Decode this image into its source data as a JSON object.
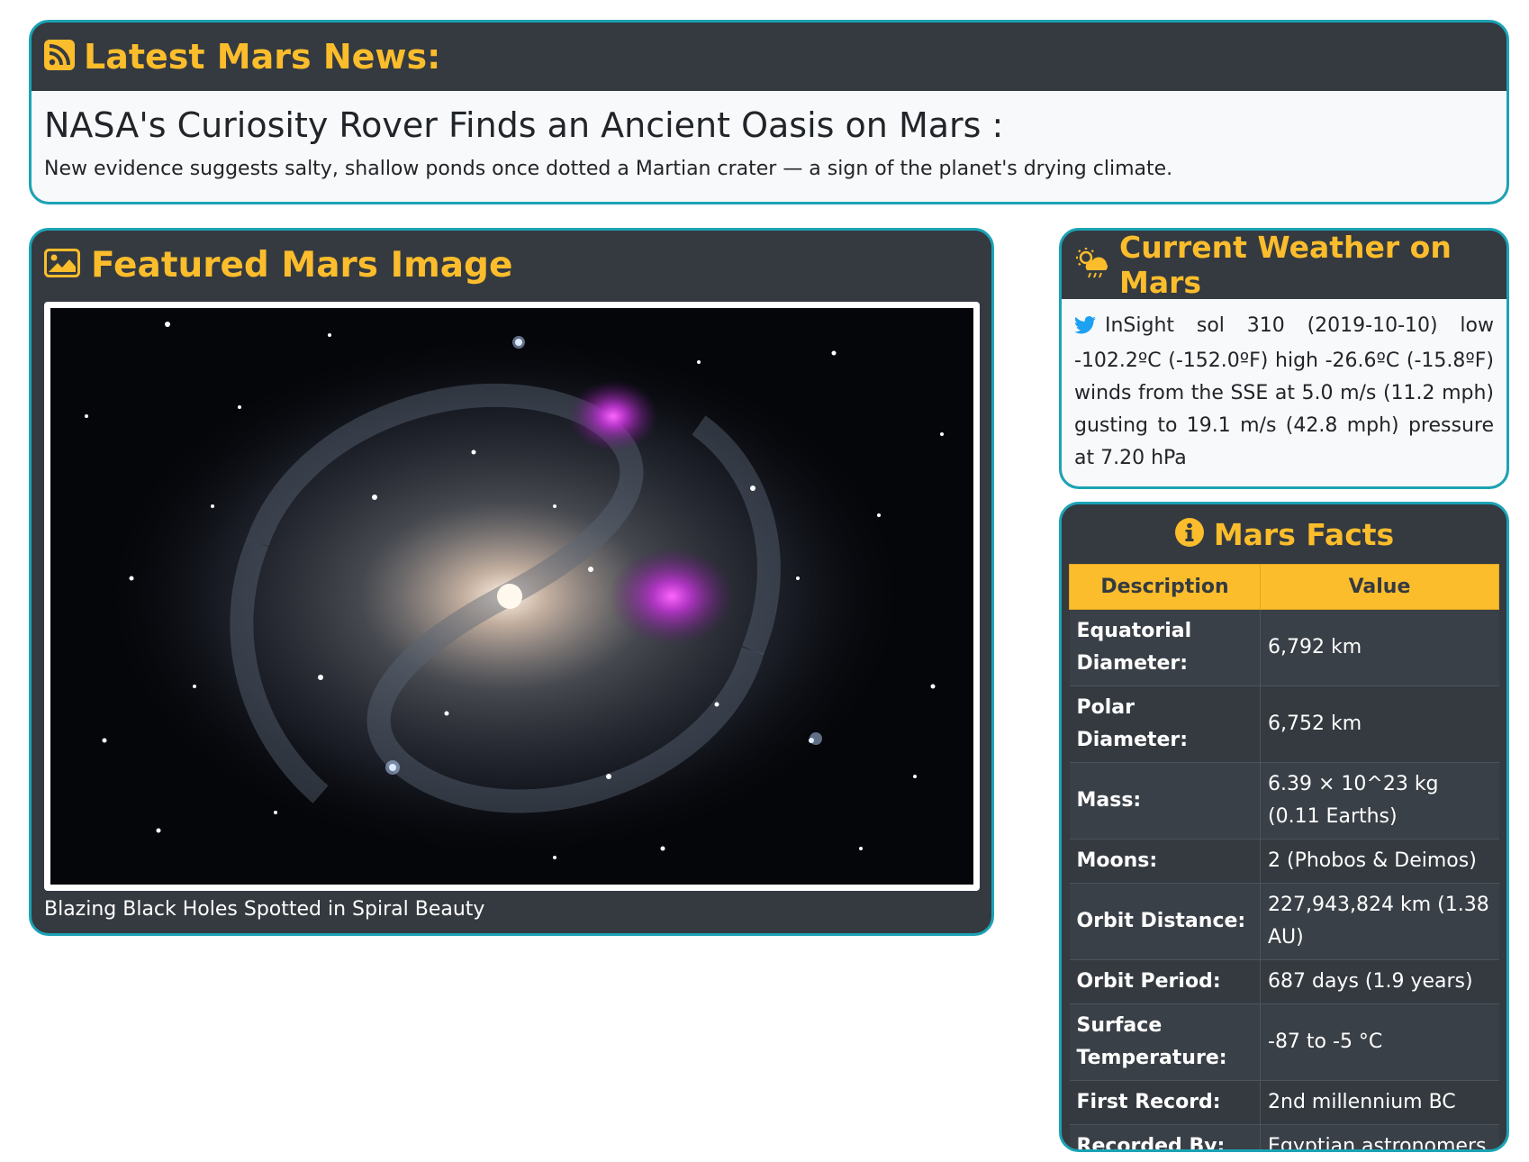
{
  "news": {
    "header": "Latest Mars News:",
    "header_icon": "rss-icon",
    "title": "NASA's Curiosity Rover Finds an Ancient Oasis on Mars :",
    "teaser": "New evidence suggests salty, shallow ponds once dotted a Martian crater — a sign of the planet's drying climate."
  },
  "featured": {
    "header": "Featured Mars Image",
    "header_icon": "image-icon",
    "caption": "Blazing Black Holes Spotted in Spiral Beauty"
  },
  "weather": {
    "header": "Current Weather on Mars",
    "header_icon": "sun-cloud-rain-icon",
    "source_icon": "twitter-icon",
    "text": "InSight sol 310 (2019-10-10) low -102.2ºC (-152.0ºF) high -26.6ºC (-15.8ºF) winds from the SSE at 5.0 m/s (11.2 mph) gusting to 19.1 m/s (42.8 mph) pressure at 7.20 hPa"
  },
  "facts": {
    "header": "Mars Facts",
    "header_icon": "info-circle-icon",
    "columns": [
      "Description",
      "Value"
    ],
    "rows": [
      {
        "label": "Equatorial Diameter:",
        "value": "6,792 km"
      },
      {
        "label": "Polar Diameter:",
        "value": "6,752 km"
      },
      {
        "label": "Mass:",
        "value": "6.39 × 10^23 kg (0.11 Earths)"
      },
      {
        "label": "Moons:",
        "value": "2 (Phobos & Deimos)"
      },
      {
        "label": "Orbit Distance:",
        "value": "227,943,824 km (1.38 AU)"
      },
      {
        "label": "Orbit Period:",
        "value": "687 days (1.9 years)"
      },
      {
        "label": "Surface Temperature:",
        "value": "-87 to -5 °C"
      },
      {
        "label": "First Record:",
        "value": "2nd millennium BC"
      },
      {
        "label": "Recorded By:",
        "value": "Egyptian astronomers"
      }
    ]
  },
  "colors": {
    "accent": "#fcbd2c",
    "border": "#1ba3b5",
    "dark": "#343a40"
  }
}
